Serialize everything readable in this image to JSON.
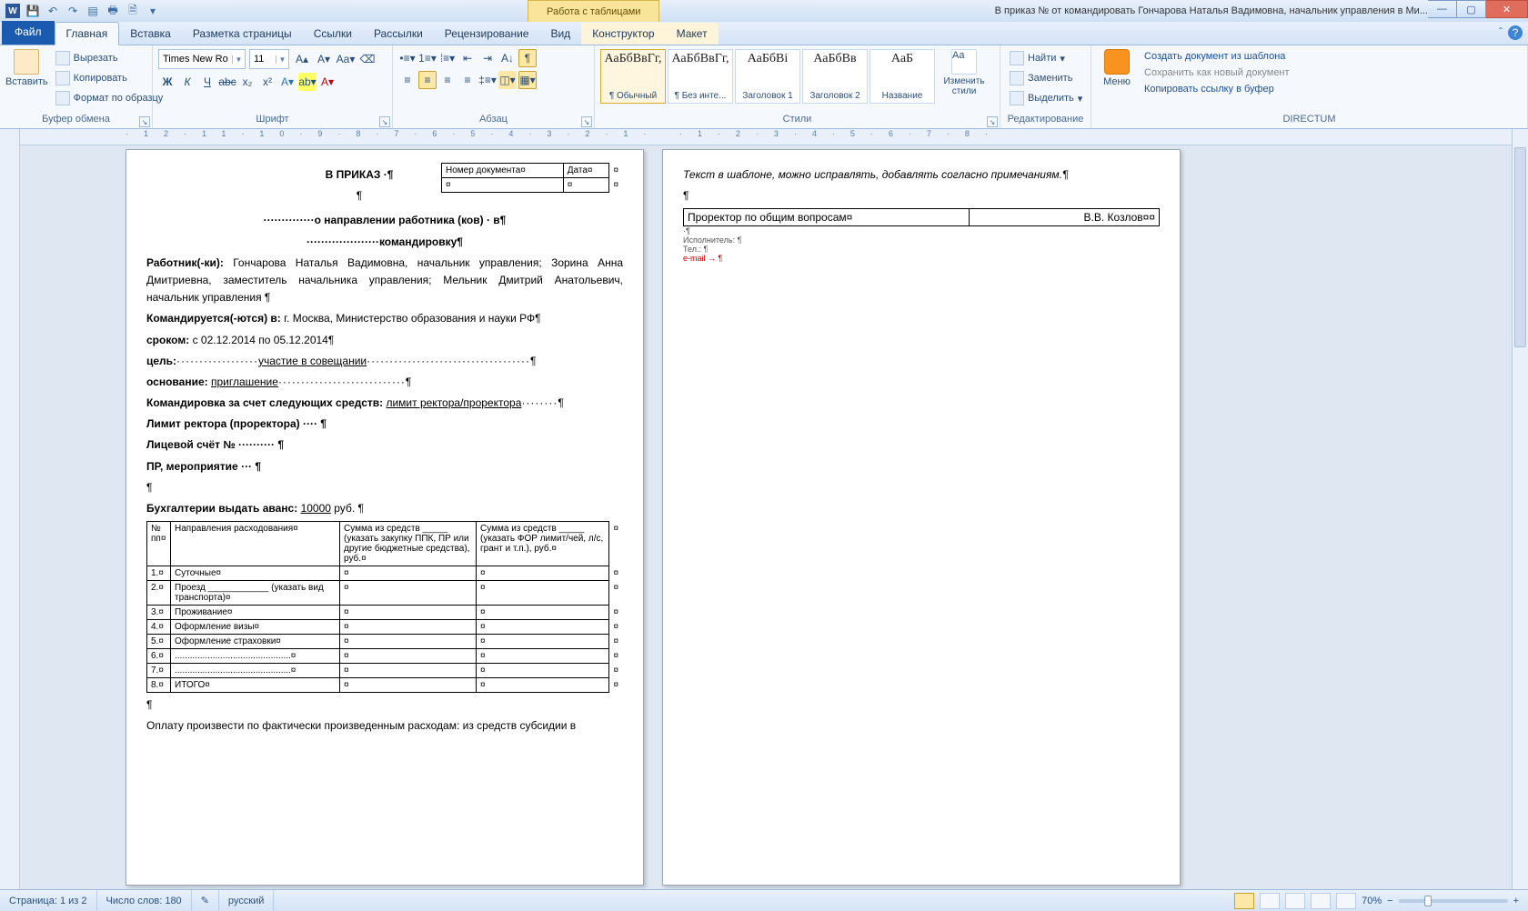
{
  "app": {
    "title": "В приказ № от  командировать Гончарова Наталья Вадимовна, начальник управления в Ми...",
    "tabletools": "Работа с таблицами"
  },
  "qat": [
    "save",
    "undo",
    "redo",
    "print",
    "preview",
    "spell",
    "more"
  ],
  "tabs": {
    "file": "Файл",
    "home": "Главная",
    "insert": "Вставка",
    "layout": "Разметка страницы",
    "refs": "Ссылки",
    "mail": "Рассылки",
    "review": "Рецензирование",
    "view": "Вид",
    "design": "Конструктор",
    "tblLayout": "Макет"
  },
  "ribbon": {
    "clipboard": {
      "label": "Буфер обмена",
      "paste": "Вставить",
      "cut": "Вырезать",
      "copy": "Копировать",
      "format": "Формат по образцу"
    },
    "font": {
      "label": "Шрифт",
      "name": "Times New Ro",
      "size": "11"
    },
    "paragraph": {
      "label": "Абзац"
    },
    "styles": {
      "label": "Стили",
      "items": [
        {
          "preview": "АаБбВвГг,",
          "name": "¶ Обычный",
          "sel": true
        },
        {
          "preview": "АаБбВвГг,",
          "name": "¶ Без инте..."
        },
        {
          "preview": "АаБбВі",
          "name": "Заголовок 1"
        },
        {
          "preview": "АаБбВв",
          "name": "Заголовок 2"
        },
        {
          "preview": "АаБ",
          "name": "Название"
        }
      ],
      "change": "Изменить стили"
    },
    "editing": {
      "label": "Редактирование",
      "find": "Найти",
      "replace": "Заменить",
      "select": "Выделить"
    },
    "directum": {
      "label": "DIRECTUM",
      "menu": "Меню",
      "l1": "Создать документ из шаблона",
      "l2": "Сохранить как новый документ",
      "l3": "Копировать ссылку в буфер"
    }
  },
  "rulerLabel": "L",
  "doc": {
    "headerTitle": "В ПРИКАЗ ·¶",
    "docnum": "Номер документа¤",
    "date": "Дата¤",
    "l1": "··············о направлении работника (ков) · в¶",
    "l2": "····················командировку¶",
    "workers_lbl": "Работник(-ки):",
    "workers_val": " Гончарова Наталья Вадимовна, начальник управления; Зорина Анна Дмитриевна, заместитель начальника управления; Мельник Дмитрий Анатольевич, начальник управления ¶",
    "dest_lbl": "Командируется(-ются) в:",
    "dest_val": " г. Москва, Министерство образования и науки РФ¶",
    "term_lbl": "сроком:",
    "term_val": " с 02.12.2014 по 05.12.2014¶",
    "goal_lbl": "цель:",
    "goal_val": "участие в совещании",
    "base_lbl": "основание:",
    "base_val": "приглашение",
    "funds_lbl": "Командировка за счет следующих средств:",
    "funds_val": "лимит ректора/проректора",
    "limit": "Лимит ректора (проректора) ···· ¶",
    "account": "Лицевой счёт № ·········· ¶",
    "event": "ПР, мероприятие ··· ¶",
    "advance_lbl": "Бухгалтерии выдать аванс:",
    "advance_val": "10000",
    "advance_unit": " руб. ¶",
    "table": {
      "h1": "№ пп¤",
      "h2": "Направления расходования¤",
      "h3": "Сумма из средств _____ (указать закупку ППК, ПР или другие бюджетные средства), руб.¤",
      "h4": "Сумма из средств _____ (указать ФОР лимит/чей, л/с, грант и т.п.), руб.¤",
      "rows": [
        {
          "n": "1.¤",
          "d": "Суточные¤"
        },
        {
          "n": "2.¤",
          "d": "Проезд ____________ (указать вид транспорта)¤"
        },
        {
          "n": "3.¤",
          "d": "Проживание¤"
        },
        {
          "n": "4.¤",
          "d": "Оформление визы¤"
        },
        {
          "n": "5.¤",
          "d": "Оформление страховки¤"
        },
        {
          "n": "6.¤",
          "d": "..............................................¤"
        },
        {
          "n": "7.¤",
          "d": "..............................................¤"
        },
        {
          "n": "8.¤",
          "d": "ИТОГО¤"
        }
      ]
    },
    "footer": "Оплату произвести по фактически произведенным расходам: из средств субсидии в"
  },
  "page2": {
    "note": "Текст в шаблоне, можно исправлять, добавлять согласно примечаниям.¶",
    "sign_role": "Проректор по общим вопросам¤",
    "sign_name": "В.В. Козлов¤¤",
    "exec": "Исполнитель: ¶",
    "tel": "Тел.: ¶",
    "email": "e-mail  → ¶"
  },
  "status": {
    "page": "Страница: 1 из 2",
    "words": "Число слов: 180",
    "lang": "русский",
    "zoom": "70%"
  }
}
